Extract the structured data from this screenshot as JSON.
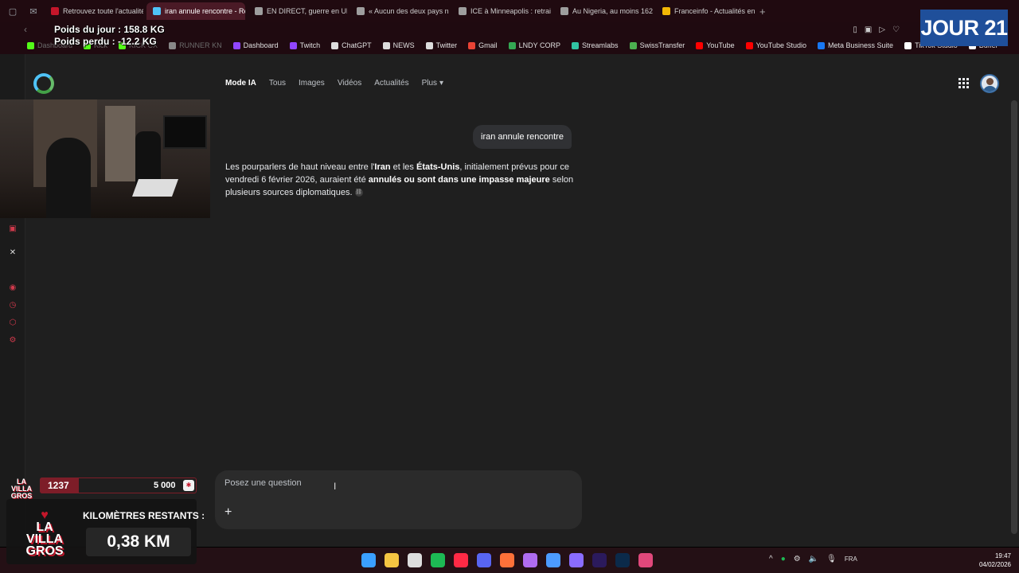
{
  "tabs": [
    {
      "label": "Retrouvez toute l'actualité",
      "active": false,
      "color": "#c4162a"
    },
    {
      "label": "iran annule rencontre - Re",
      "active": true,
      "color": "#4fc3f7"
    },
    {
      "label": "EN DIRECT, guerre en Ukr",
      "active": false,
      "color": "#9e9e9e"
    },
    {
      "label": "« Aucun des deux pays ne",
      "active": false,
      "color": "#9e9e9e"
    },
    {
      "label": "ICE à Minneapolis : retrait",
      "active": false,
      "color": "#9e9e9e"
    },
    {
      "label": "Au Nigeria, au moins 162 p",
      "active": false,
      "color": "#9e9e9e"
    },
    {
      "label": "Franceinfo - Actualités en",
      "active": false,
      "color": "#f2b705"
    }
  ],
  "overlay": {
    "weight_today": "Poids du jour : 158.8 KG",
    "weight_lost": "Poids perdu : -12.2 KG",
    "day_badge": "JOUR 21"
  },
  "bookmarks": [
    {
      "label": "Dashboard",
      "color": "#53fc18",
      "dim": true
    },
    {
      "label": "Kick",
      "color": "#53fc18",
      "dim": true
    },
    {
      "label": "KICK CX",
      "color": "#53fc18",
      "dim": true
    },
    {
      "label": "RUNNER KN",
      "color": "#888888",
      "dim": true
    },
    {
      "label": "Dashboard",
      "color": "#9146ff",
      "dim": false
    },
    {
      "label": "Twitch",
      "color": "#9146ff",
      "dim": false
    },
    {
      "label": "ChatGPT",
      "color": "#dddddd",
      "dim": false
    },
    {
      "label": "NEWS",
      "color": "#dddddd",
      "dim": false
    },
    {
      "label": "Twitter",
      "color": "#dddddd",
      "dim": false
    },
    {
      "label": "Gmail",
      "color": "#ea4335",
      "dim": false
    },
    {
      "label": "LNDY CORP",
      "color": "#34a853",
      "dim": false
    },
    {
      "label": "Streamlabs",
      "color": "#31c3a2",
      "dim": false
    },
    {
      "label": "SwissTransfer",
      "color": "#4caf50",
      "dim": false
    },
    {
      "label": "YouTube",
      "color": "#ff0000",
      "dim": false
    },
    {
      "label": "YouTube Studio",
      "color": "#ff0000",
      "dim": false
    },
    {
      "label": "Meta Business Suite",
      "color": "#1877f2",
      "dim": false
    },
    {
      "label": "TikTok Studio",
      "color": "#ffffff",
      "dim": false
    },
    {
      "label": "Buffer",
      "color": "#ffffff",
      "dim": false
    }
  ],
  "search": {
    "nav": [
      {
        "label": "Mode IA",
        "active": true
      },
      {
        "label": "Tous",
        "active": false
      },
      {
        "label": "Images",
        "active": false
      },
      {
        "label": "Vidéos",
        "active": false
      },
      {
        "label": "Actualités",
        "active": false
      },
      {
        "label": "Plus",
        "active": false
      }
    ],
    "query": "iran annule rencontre",
    "answer": {
      "p1": "Les pourparlers de haut niveau entre l'",
      "b1": "Iran",
      "p2": " et les ",
      "b2": "États-Unis",
      "p3": ", initialement prévus pour ce vendredi 6 février 2026, auraient été ",
      "b3": "annulés ou sont dans une impasse majeure",
      "p4": " selon plusieurs sources diplomatiques."
    },
    "ask_placeholder": "Posez une question"
  },
  "stream": {
    "progress_current": "1237",
    "progress_goal": "5 000",
    "progress_fraction": 0.25,
    "km_title": "KILOMÈTRES RESTANTS :",
    "km_value": "0,38 KM",
    "logo_line1": "LA VILLA",
    "logo_line2": "GROS"
  },
  "taskbar": {
    "lang": "FRA",
    "time": "19:47",
    "date": "04/02/2026",
    "apps": [
      {
        "name": "start",
        "color": "#3aa0ff"
      },
      {
        "name": "files",
        "color": "#f4c542"
      },
      {
        "name": "chrome",
        "color": "#dddddd"
      },
      {
        "name": "spotify",
        "color": "#1db954"
      },
      {
        "name": "opera",
        "color": "#ff2a45"
      },
      {
        "name": "discord",
        "color": "#5865f2"
      },
      {
        "name": "firefox",
        "color": "#ff7139"
      },
      {
        "name": "streamlabs",
        "color": "#b16cf0"
      },
      {
        "name": "app",
        "color": "#4c9bff"
      },
      {
        "name": "grid",
        "color": "#8a6cff"
      },
      {
        "name": "premiere",
        "color": "#2b1a5c"
      },
      {
        "name": "photoshop",
        "color": "#0b2a4a"
      },
      {
        "name": "pin",
        "color": "#e0487b"
      }
    ]
  }
}
